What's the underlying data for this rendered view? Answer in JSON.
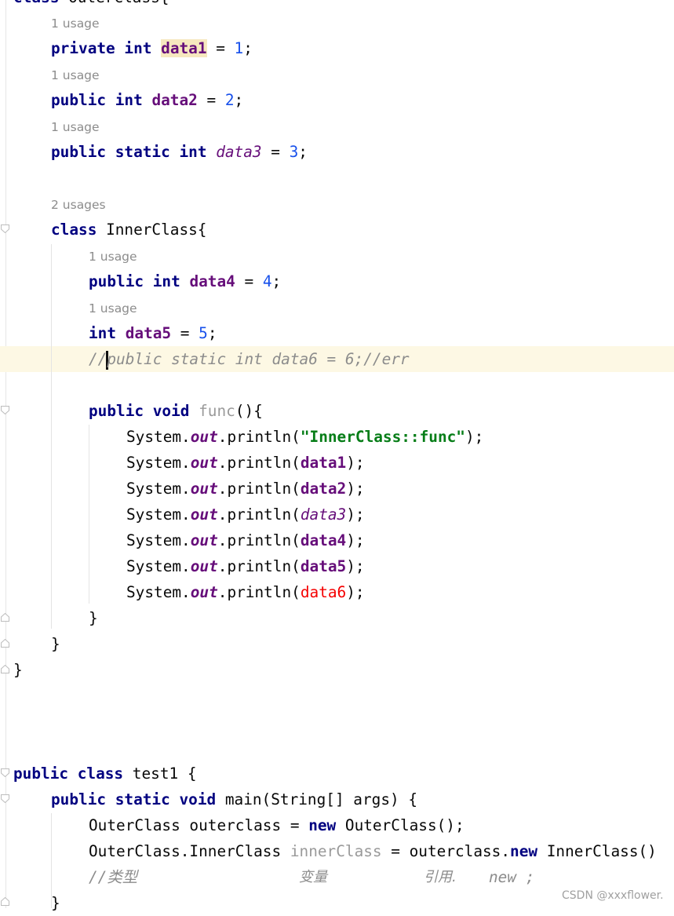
{
  "editor": {
    "line0": {
      "kw": "class",
      "name": "OuterClass{"
    },
    "usage1": "1 usage",
    "usage2": "1 usage",
    "usage3": "1 usage",
    "usage_inner": "2 usages",
    "usage4": "1 usage",
    "usage5": "1 usage",
    "line_data1": {
      "mod": "private",
      "type": "int",
      "name": "data1",
      "eq": " = ",
      "val": "1",
      "end": ";"
    },
    "line_data2": {
      "mod": "public",
      "type": "int",
      "name": "data2",
      "eq": " = ",
      "val": "2",
      "end": ";"
    },
    "line_data3": {
      "mod": "public",
      "mod2": "static",
      "type": "int",
      "name": "data3",
      "eq": " = ",
      "val": "3",
      "end": ";"
    },
    "line_inner": {
      "kw": "class",
      "name": "InnerClass{"
    },
    "line_data4": {
      "mod": "public",
      "type": "int",
      "name": "data4",
      "eq": " = ",
      "val": "4",
      "end": ";"
    },
    "line_data5": {
      "type": "int",
      "name": "data5",
      "eq": " = ",
      "val": "5",
      "end": ";"
    },
    "line_comment": {
      "pre": "//",
      "rest": "public static int data6 = 6;//err"
    },
    "line_func": {
      "mod": "public",
      "type": "void",
      "name": "func",
      "rest": "(){"
    },
    "print_lines": [
      {
        "pre": "System.",
        "out": "out",
        "mid": ".println(",
        "arg": "\"InnerClass::func\"",
        "end": ");"
      },
      {
        "pre": "System.",
        "out": "out",
        "mid": ".println(",
        "arg": "data1",
        "end": ");"
      },
      {
        "pre": "System.",
        "out": "out",
        "mid": ".println(",
        "arg": "data2",
        "end": ");"
      },
      {
        "pre": "System.",
        "out": "out",
        "mid": ".println(",
        "arg": "data3",
        "end": ");"
      },
      {
        "pre": "System.",
        "out": "out",
        "mid": ".println(",
        "arg": "data4",
        "end": ");"
      },
      {
        "pre": "System.",
        "out": "out",
        "mid": ".println(",
        "arg": "data5",
        "end": ");"
      },
      {
        "pre": "System.",
        "out": "out",
        "mid": ".println(",
        "arg": "data6",
        "end": ");"
      }
    ],
    "close_func": "}",
    "close_inner": "}",
    "close_outer": "}",
    "line_test1": {
      "mod": "public",
      "kw": "class",
      "name": "test1 {"
    },
    "line_main": {
      "mod": "public",
      "mod2": "static",
      "type": "void",
      "rest": "main(String[] args) {"
    },
    "line_new_outer": {
      "a": "OuterClass outerclass = ",
      "kw": "new",
      "b": " OuterClass();"
    },
    "line_new_inner": {
      "a": "OuterClass.InnerClass ",
      "var": "innerClass",
      "b": " = outerclass.",
      "kw": "new",
      "c": " InnerClass()"
    },
    "line_cjk_comment": {
      "pre": "//",
      "t1": "类型",
      "t2": "变量",
      "t3": "引用.",
      "t4": "new ;"
    },
    "close_main": "}"
  },
  "watermark": "CSDN @xxxflower.",
  "colors": {
    "keyword": "#000080",
    "field": "#660e7a",
    "number": "#1750eb",
    "string": "#067d17",
    "comment": "#8c8c8c",
    "error": "#f50000",
    "current_line": "#fdf8e4"
  }
}
